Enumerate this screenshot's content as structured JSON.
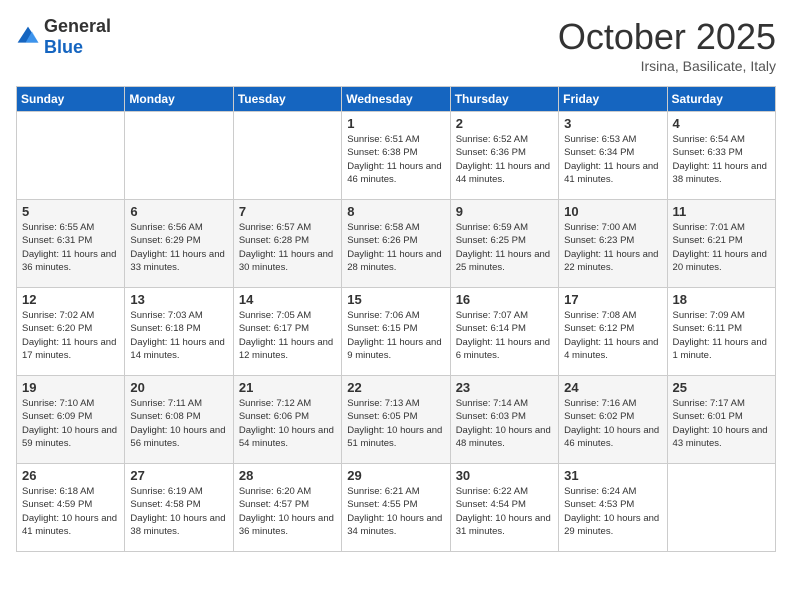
{
  "header": {
    "logo": {
      "general": "General",
      "blue": "Blue"
    },
    "title": "October 2025",
    "subtitle": "Irsina, Basilicate, Italy"
  },
  "weekdays": [
    "Sunday",
    "Monday",
    "Tuesday",
    "Wednesday",
    "Thursday",
    "Friday",
    "Saturday"
  ],
  "weeks": [
    [
      {
        "day": "",
        "info": ""
      },
      {
        "day": "",
        "info": ""
      },
      {
        "day": "",
        "info": ""
      },
      {
        "day": "1",
        "info": "Sunrise: 6:51 AM\nSunset: 6:38 PM\nDaylight: 11 hours\nand 46 minutes."
      },
      {
        "day": "2",
        "info": "Sunrise: 6:52 AM\nSunset: 6:36 PM\nDaylight: 11 hours\nand 44 minutes."
      },
      {
        "day": "3",
        "info": "Sunrise: 6:53 AM\nSunset: 6:34 PM\nDaylight: 11 hours\nand 41 minutes."
      },
      {
        "day": "4",
        "info": "Sunrise: 6:54 AM\nSunset: 6:33 PM\nDaylight: 11 hours\nand 38 minutes."
      }
    ],
    [
      {
        "day": "5",
        "info": "Sunrise: 6:55 AM\nSunset: 6:31 PM\nDaylight: 11 hours\nand 36 minutes."
      },
      {
        "day": "6",
        "info": "Sunrise: 6:56 AM\nSunset: 6:29 PM\nDaylight: 11 hours\nand 33 minutes."
      },
      {
        "day": "7",
        "info": "Sunrise: 6:57 AM\nSunset: 6:28 PM\nDaylight: 11 hours\nand 30 minutes."
      },
      {
        "day": "8",
        "info": "Sunrise: 6:58 AM\nSunset: 6:26 PM\nDaylight: 11 hours\nand 28 minutes."
      },
      {
        "day": "9",
        "info": "Sunrise: 6:59 AM\nSunset: 6:25 PM\nDaylight: 11 hours\nand 25 minutes."
      },
      {
        "day": "10",
        "info": "Sunrise: 7:00 AM\nSunset: 6:23 PM\nDaylight: 11 hours\nand 22 minutes."
      },
      {
        "day": "11",
        "info": "Sunrise: 7:01 AM\nSunset: 6:21 PM\nDaylight: 11 hours\nand 20 minutes."
      }
    ],
    [
      {
        "day": "12",
        "info": "Sunrise: 7:02 AM\nSunset: 6:20 PM\nDaylight: 11 hours\nand 17 minutes."
      },
      {
        "day": "13",
        "info": "Sunrise: 7:03 AM\nSunset: 6:18 PM\nDaylight: 11 hours\nand 14 minutes."
      },
      {
        "day": "14",
        "info": "Sunrise: 7:05 AM\nSunset: 6:17 PM\nDaylight: 11 hours\nand 12 minutes."
      },
      {
        "day": "15",
        "info": "Sunrise: 7:06 AM\nSunset: 6:15 PM\nDaylight: 11 hours\nand 9 minutes."
      },
      {
        "day": "16",
        "info": "Sunrise: 7:07 AM\nSunset: 6:14 PM\nDaylight: 11 hours\nand 6 minutes."
      },
      {
        "day": "17",
        "info": "Sunrise: 7:08 AM\nSunset: 6:12 PM\nDaylight: 11 hours\nand 4 minutes."
      },
      {
        "day": "18",
        "info": "Sunrise: 7:09 AM\nSunset: 6:11 PM\nDaylight: 11 hours\nand 1 minute."
      }
    ],
    [
      {
        "day": "19",
        "info": "Sunrise: 7:10 AM\nSunset: 6:09 PM\nDaylight: 10 hours\nand 59 minutes."
      },
      {
        "day": "20",
        "info": "Sunrise: 7:11 AM\nSunset: 6:08 PM\nDaylight: 10 hours\nand 56 minutes."
      },
      {
        "day": "21",
        "info": "Sunrise: 7:12 AM\nSunset: 6:06 PM\nDaylight: 10 hours\nand 54 minutes."
      },
      {
        "day": "22",
        "info": "Sunrise: 7:13 AM\nSunset: 6:05 PM\nDaylight: 10 hours\nand 51 minutes."
      },
      {
        "day": "23",
        "info": "Sunrise: 7:14 AM\nSunset: 6:03 PM\nDaylight: 10 hours\nand 48 minutes."
      },
      {
        "day": "24",
        "info": "Sunrise: 7:16 AM\nSunset: 6:02 PM\nDaylight: 10 hours\nand 46 minutes."
      },
      {
        "day": "25",
        "info": "Sunrise: 7:17 AM\nSunset: 6:01 PM\nDaylight: 10 hours\nand 43 minutes."
      }
    ],
    [
      {
        "day": "26",
        "info": "Sunrise: 6:18 AM\nSunset: 4:59 PM\nDaylight: 10 hours\nand 41 minutes."
      },
      {
        "day": "27",
        "info": "Sunrise: 6:19 AM\nSunset: 4:58 PM\nDaylight: 10 hours\nand 38 minutes."
      },
      {
        "day": "28",
        "info": "Sunrise: 6:20 AM\nSunset: 4:57 PM\nDaylight: 10 hours\nand 36 minutes."
      },
      {
        "day": "29",
        "info": "Sunrise: 6:21 AM\nSunset: 4:55 PM\nDaylight: 10 hours\nand 34 minutes."
      },
      {
        "day": "30",
        "info": "Sunrise: 6:22 AM\nSunset: 4:54 PM\nDaylight: 10 hours\nand 31 minutes."
      },
      {
        "day": "31",
        "info": "Sunrise: 6:24 AM\nSunset: 4:53 PM\nDaylight: 10 hours\nand 29 minutes."
      },
      {
        "day": "",
        "info": ""
      }
    ]
  ]
}
